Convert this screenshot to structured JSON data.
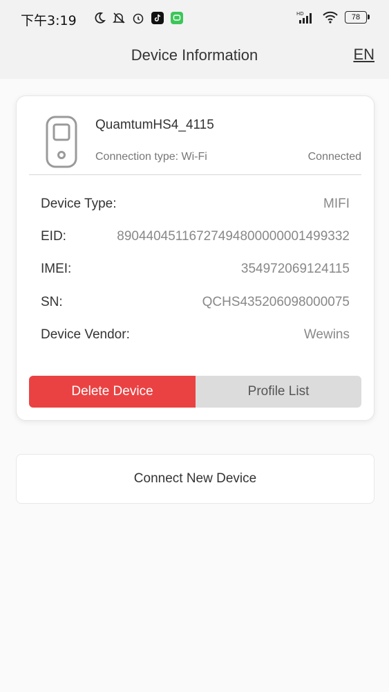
{
  "status_bar": {
    "time": "下午3:19",
    "battery": "78",
    "left_icons": [
      "moon-icon",
      "bell-off-icon",
      "alarm-icon",
      "tiktok-icon",
      "messaging-icon"
    ],
    "right_icons": [
      "hd-signal-icon",
      "wifi-icon",
      "battery-icon"
    ]
  },
  "header": {
    "title": "Device Information",
    "language": "EN"
  },
  "device": {
    "name": "QuamtumHS4_4115",
    "connection_type": "Connection type: Wi-Fi",
    "status": "Connected",
    "details": [
      {
        "label": "Device Type:",
        "value": "MIFI"
      },
      {
        "label": "EID:",
        "value": "89044045116727494800000001499332"
      },
      {
        "label": "IMEI:",
        "value": "354972069124115"
      },
      {
        "label": "SN:",
        "value": "QCHS435206098000075"
      },
      {
        "label": "Device Vendor:",
        "value": "Wewins"
      }
    ]
  },
  "actions": {
    "delete_label": "Delete Device",
    "profile_label": "Profile List",
    "connect_label": "Connect New Device"
  },
  "colors": {
    "accent_red": "#ea4243",
    "secondary_gray": "#dcdcdc",
    "header_bg": "#f2f2f2"
  }
}
